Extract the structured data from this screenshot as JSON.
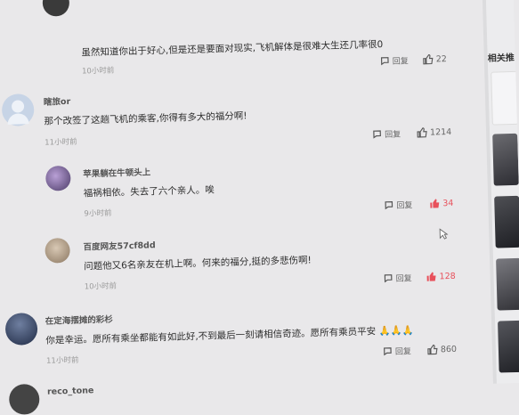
{
  "comments": [
    {
      "text": "虽然知道你出于好心,但是还是要面对现实,飞机解体是很难大生还几率很0",
      "time": "10小时前",
      "reply_label": "回复",
      "likes": "22",
      "liked": false
    },
    {
      "username": "瞎旅or",
      "text": "那个改签了这趟飞机的乘客,你得有多大的福分啊!",
      "time": "11小时前",
      "reply_label": "回复",
      "likes": "1214",
      "liked": false
    },
    {
      "username": "苹果躺在牛顿头上",
      "text": "福祸相依。失去了六个亲人。唉",
      "time": "9小时前",
      "reply_label": "回复",
      "likes": "34",
      "liked": true
    },
    {
      "username": "百度网友57cf8dd",
      "text": "问题他又6名亲友在机上啊。何来的福分,挺的多悲伤啊!",
      "time": "10小时前",
      "reply_label": "回复",
      "likes": "128",
      "liked": true
    },
    {
      "username": "在定海摆摊的彩杉",
      "text": "你是幸运。愿所有乘坐都能有如此好,不到最后一刻请相信奇迹。愿所有乘员平安 🙏🙏🙏",
      "time": "11小时前",
      "reply_label": "回复",
      "likes": "860",
      "liked": false
    },
    {
      "username": "reco_tone"
    }
  ],
  "sidebar": {
    "title": "相关推"
  },
  "colors": {
    "liked": "#e8505b",
    "background": "#e9e8ea"
  },
  "icons": [
    "comment-icon",
    "thumb-up-icon",
    "thumb-up-filled-icon"
  ]
}
